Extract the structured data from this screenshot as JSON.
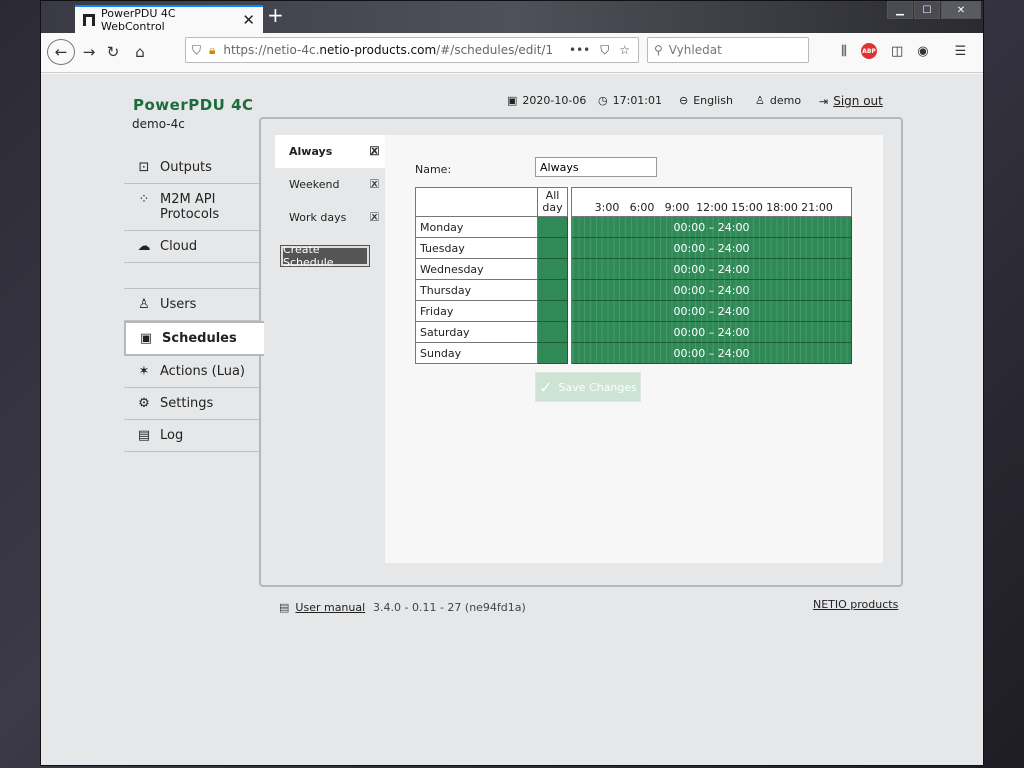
{
  "browser": {
    "tab_title": "PowerPDU 4C WebControl",
    "url_prefix": "https://netio-4c.",
    "url_domain": "netio-products.com",
    "url_suffix": "/#/schedules/edit/1",
    "search_placeholder": "Vyhledat",
    "url_more": "•••"
  },
  "header": {
    "brand": "PowerPDU 4C",
    "device_name": "demo-4c",
    "date": "2020-10-06",
    "time": "17:01:01",
    "language": "English",
    "user": "demo",
    "signout": "Sign out"
  },
  "sidebar": {
    "items": [
      {
        "label": "Outputs",
        "icon": "outputs-icon"
      },
      {
        "label": "M2M API",
        "label2": "Protocols",
        "icon": "m2m-icon"
      },
      {
        "label": "Cloud",
        "icon": "cloud-icon"
      },
      {
        "label": "Users",
        "icon": "user-icon"
      },
      {
        "label": "Schedules",
        "icon": "calendar-icon"
      },
      {
        "label": "Actions (Lua)",
        "icon": "wand-icon"
      },
      {
        "label": "Settings",
        "icon": "gear-icon"
      },
      {
        "label": "Log",
        "icon": "document-icon"
      }
    ]
  },
  "schedules": {
    "list": [
      "Always",
      "Weekend",
      "Work days"
    ],
    "create_label": "Create Schedule"
  },
  "editor": {
    "name_label": "Name:",
    "name_value": "Always",
    "allday_header": "All day",
    "ticks": [
      "3:00",
      "6:00",
      "9:00",
      "12:00",
      "15:00",
      "18:00",
      "21:00"
    ],
    "days": [
      {
        "day": "Monday",
        "range": "00:00 – 24:00"
      },
      {
        "day": "Tuesday",
        "range": "00:00 – 24:00"
      },
      {
        "day": "Wednesday",
        "range": "00:00 – 24:00"
      },
      {
        "day": "Thursday",
        "range": "00:00 – 24:00"
      },
      {
        "day": "Friday",
        "range": "00:00 – 24:00"
      },
      {
        "day": "Saturday",
        "range": "00:00 – 24:00"
      },
      {
        "day": "Sunday",
        "range": "00:00 – 24:00"
      }
    ],
    "save_label": "Save Changes"
  },
  "footer": {
    "manual": "User manual",
    "version": "3.4.0 - 0.11 - 27 (ne94fd1a)",
    "company": "NETIO products"
  },
  "colors": {
    "accent_green": "#2f8a57",
    "brand_green": "#1d6b3e"
  }
}
